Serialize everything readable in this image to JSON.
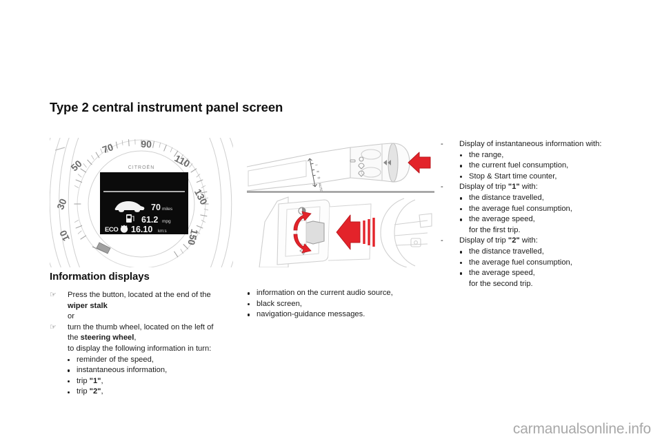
{
  "page": {
    "title": "Type 2 central instrument panel screen",
    "watermark": "carmanualsonline.info"
  },
  "cluster_figure": {
    "brand": "CITROËN",
    "dial_ticks": [
      "30",
      "50",
      "70",
      "90",
      "110",
      "130",
      "150"
    ],
    "display": {
      "range_value": "70",
      "range_unit": "miles",
      "consumption_value": "61.2",
      "consumption_unit": "mpg",
      "eco_label": "ECO",
      "timer_value": "16.10",
      "timer_unit": "km:s"
    }
  },
  "stalk_figure": {
    "wiper_marks": [
      "I",
      "II",
      "0",
      "AUTO"
    ],
    "arrow_top": "press-button-arrow",
    "arrow_bottom": "thumb-wheel-arrow"
  },
  "left_column": {
    "heading": "Information displays",
    "step1": {
      "line1": "Press the button, located at the end of the",
      "line2_bold": "wiper stalk",
      "line3": "or"
    },
    "step2": {
      "line1": "turn the thumb wheel, located on the left of",
      "line2_prefix": "the ",
      "line2_bold": "steering wheel",
      "line2_suffix": ",",
      "line3": "to display the following information in turn:"
    },
    "bullets": [
      {
        "text": "reminder of the speed,"
      },
      {
        "text": "instantaneous information,"
      },
      {
        "prefix": "trip ",
        "bold": "\"1\"",
        "suffix": ","
      },
      {
        "prefix": "trip ",
        "bold": "\"2\"",
        "suffix": ","
      }
    ]
  },
  "middle_column": {
    "bullets": [
      "information on the current audio source,",
      "black screen,",
      "navigation-guidance messages."
    ]
  },
  "right_column": {
    "groups": [
      {
        "header_prefix": "Display of instantaneous information with:",
        "header_bold": "",
        "header_suffix": "",
        "items": [
          "the range,",
          "the current fuel consumption,",
          "Stop & Start time counter,"
        ],
        "tail": ""
      },
      {
        "header_prefix": "Display of trip ",
        "header_bold": "\"1\"",
        "header_suffix": " with:",
        "items": [
          "the distance travelled,",
          "the average fuel consumption,",
          "the average speed,"
        ],
        "tail": "for the first trip."
      },
      {
        "header_prefix": "Display of trip ",
        "header_bold": "\"2\"",
        "header_suffix": " with:",
        "items": [
          "the distance travelled,",
          "the average fuel consumption,",
          "the average speed,"
        ],
        "tail": "for the second trip."
      }
    ]
  },
  "colors": {
    "arrow_red": "#e3232a",
    "line_grey": "#9a9a9a",
    "watermark_grey": "#a8a8a8"
  }
}
